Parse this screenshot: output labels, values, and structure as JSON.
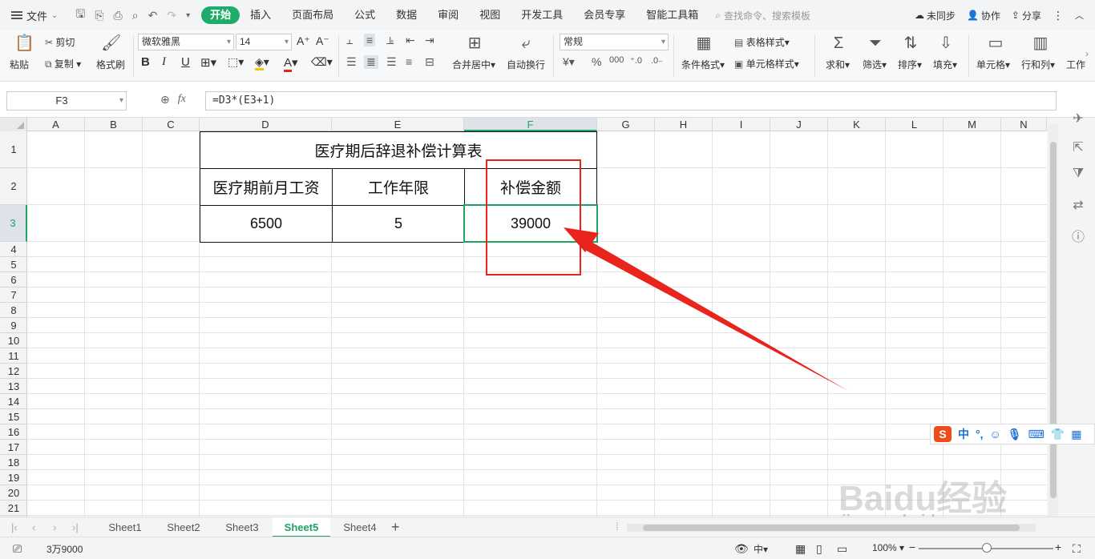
{
  "menubar": {
    "file_label": "文件",
    "tabs": [
      {
        "label": "开始",
        "active": true
      },
      {
        "label": "插入",
        "active": false
      },
      {
        "label": "页面布局",
        "active": false
      },
      {
        "label": "公式",
        "active": false
      },
      {
        "label": "数据",
        "active": false
      },
      {
        "label": "审阅",
        "active": false
      },
      {
        "label": "视图",
        "active": false
      },
      {
        "label": "开发工具",
        "active": false
      },
      {
        "label": "会员专享",
        "active": false
      },
      {
        "label": "智能工具箱",
        "active": false
      }
    ],
    "search_placeholder": "查找命令、搜索模板",
    "sync": "未同步",
    "collab": "协作",
    "share": "分享"
  },
  "ribbon": {
    "paste": "粘贴",
    "cut": "剪切",
    "copy": "复制",
    "format_painter": "格式刷",
    "font_name": "微软雅黑",
    "font_size": "14",
    "merge_center": "合并居中",
    "wrap_text": "自动换行",
    "number_format": "常规",
    "conditional_format": "条件格式",
    "table_style": "表格样式",
    "cell_style": "单元格样式",
    "sum": "求和",
    "filter": "筛选",
    "sort": "排序",
    "fill": "填充",
    "cell": "单元格",
    "rows_cols": "行和列",
    "worksheet": "工作"
  },
  "formula_bar": {
    "name_box": "F3",
    "formula": "=D3*(E3+1)"
  },
  "grid": {
    "columns": [
      "A",
      "B",
      "C",
      "D",
      "E",
      "F",
      "G",
      "H",
      "I",
      "J",
      "K",
      "L",
      "M",
      "N"
    ],
    "rows": [
      "1",
      "2",
      "3",
      "4",
      "5",
      "6",
      "7",
      "8",
      "9",
      "10",
      "11",
      "12",
      "13",
      "14",
      "15",
      "16",
      "17",
      "18",
      "19",
      "20",
      "21"
    ],
    "selected_column": "F",
    "selected_row": "3"
  },
  "table": {
    "title": "医疗期后辞退补偿计算表",
    "headers": [
      "医疗期前月工资",
      "工作年限",
      "补偿金额"
    ],
    "values": [
      "6500",
      "5",
      "39000"
    ]
  },
  "sheets": {
    "tabs": [
      "Sheet1",
      "Sheet2",
      "Sheet3",
      "Sheet5",
      "Sheet4"
    ],
    "active": "Sheet5"
  },
  "status": {
    "sum_display": "3万9000",
    "zoom": "100%"
  },
  "ime": {
    "logo": "S",
    "mode": "中"
  },
  "watermark": {
    "brand": "Baidu经验",
    "url": "jingyan.baidu.com"
  },
  "colors": {
    "accent": "#1fab6a",
    "selection": "#21a366",
    "annotation": "#e8241c"
  }
}
